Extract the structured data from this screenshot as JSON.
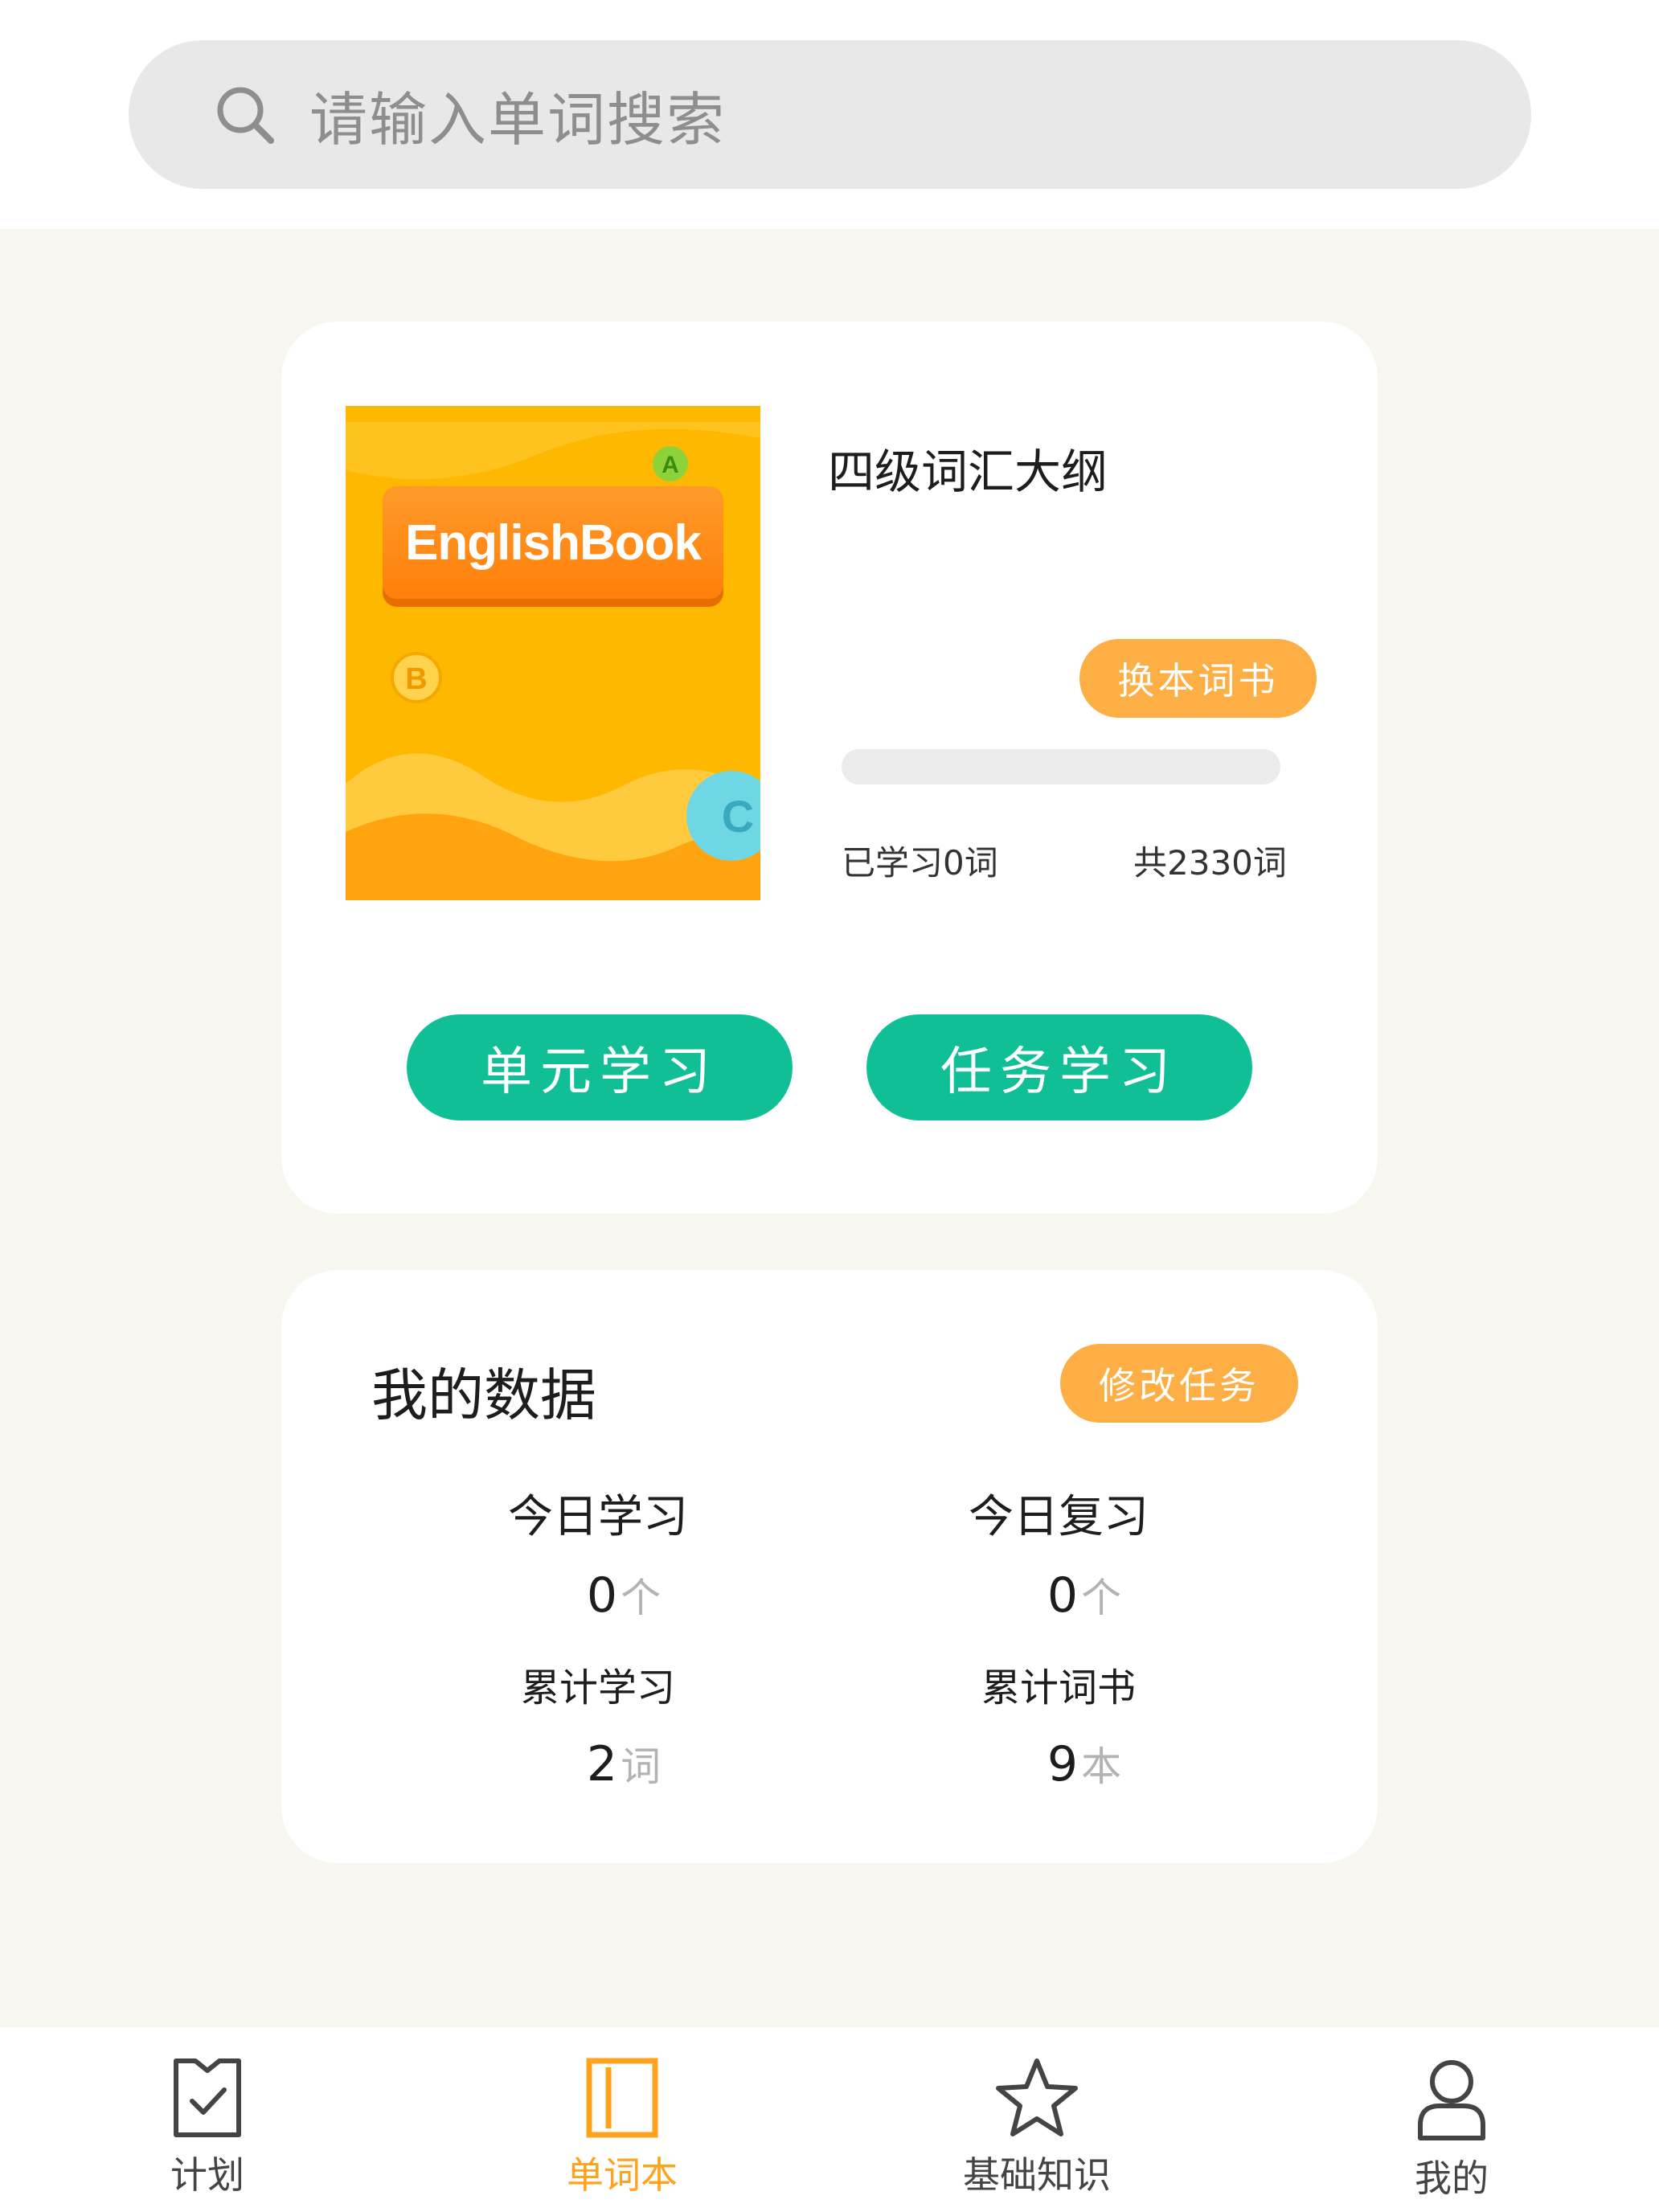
{
  "search": {
    "placeholder": "请输入单词搜索"
  },
  "book": {
    "cover_title": "EnglishBook",
    "cover_letters": [
      "A",
      "B",
      "C"
    ],
    "name": "四级词汇大纲",
    "change_label": "换本词书",
    "progress": 0,
    "learned_text": "已学习0词",
    "total_text": "共2330词",
    "unit_study_label": "单元学习",
    "task_study_label": "任务学习"
  },
  "my_data": {
    "title": "我的数据",
    "modify_label": "修改任务",
    "stats": [
      {
        "label": "今日学习",
        "value": "0",
        "unit": "个"
      },
      {
        "label": "今日复习",
        "value": "0",
        "unit": "个"
      },
      {
        "label": "累计学习",
        "value": "2",
        "unit": "词"
      },
      {
        "label": "累计词书",
        "value": "9",
        "unit": "本"
      }
    ]
  },
  "tabs": [
    {
      "label": "计划",
      "icon": "plan-check-icon"
    },
    {
      "label": "单词本",
      "icon": "wordbook-icon"
    },
    {
      "label": "基础知识",
      "icon": "star-icon"
    },
    {
      "label": "我的",
      "icon": "user-icon"
    }
  ],
  "colors": {
    "accent_green": "#10bf96",
    "accent_orange": "#fdae45",
    "tab_active": "#ffa21c"
  }
}
